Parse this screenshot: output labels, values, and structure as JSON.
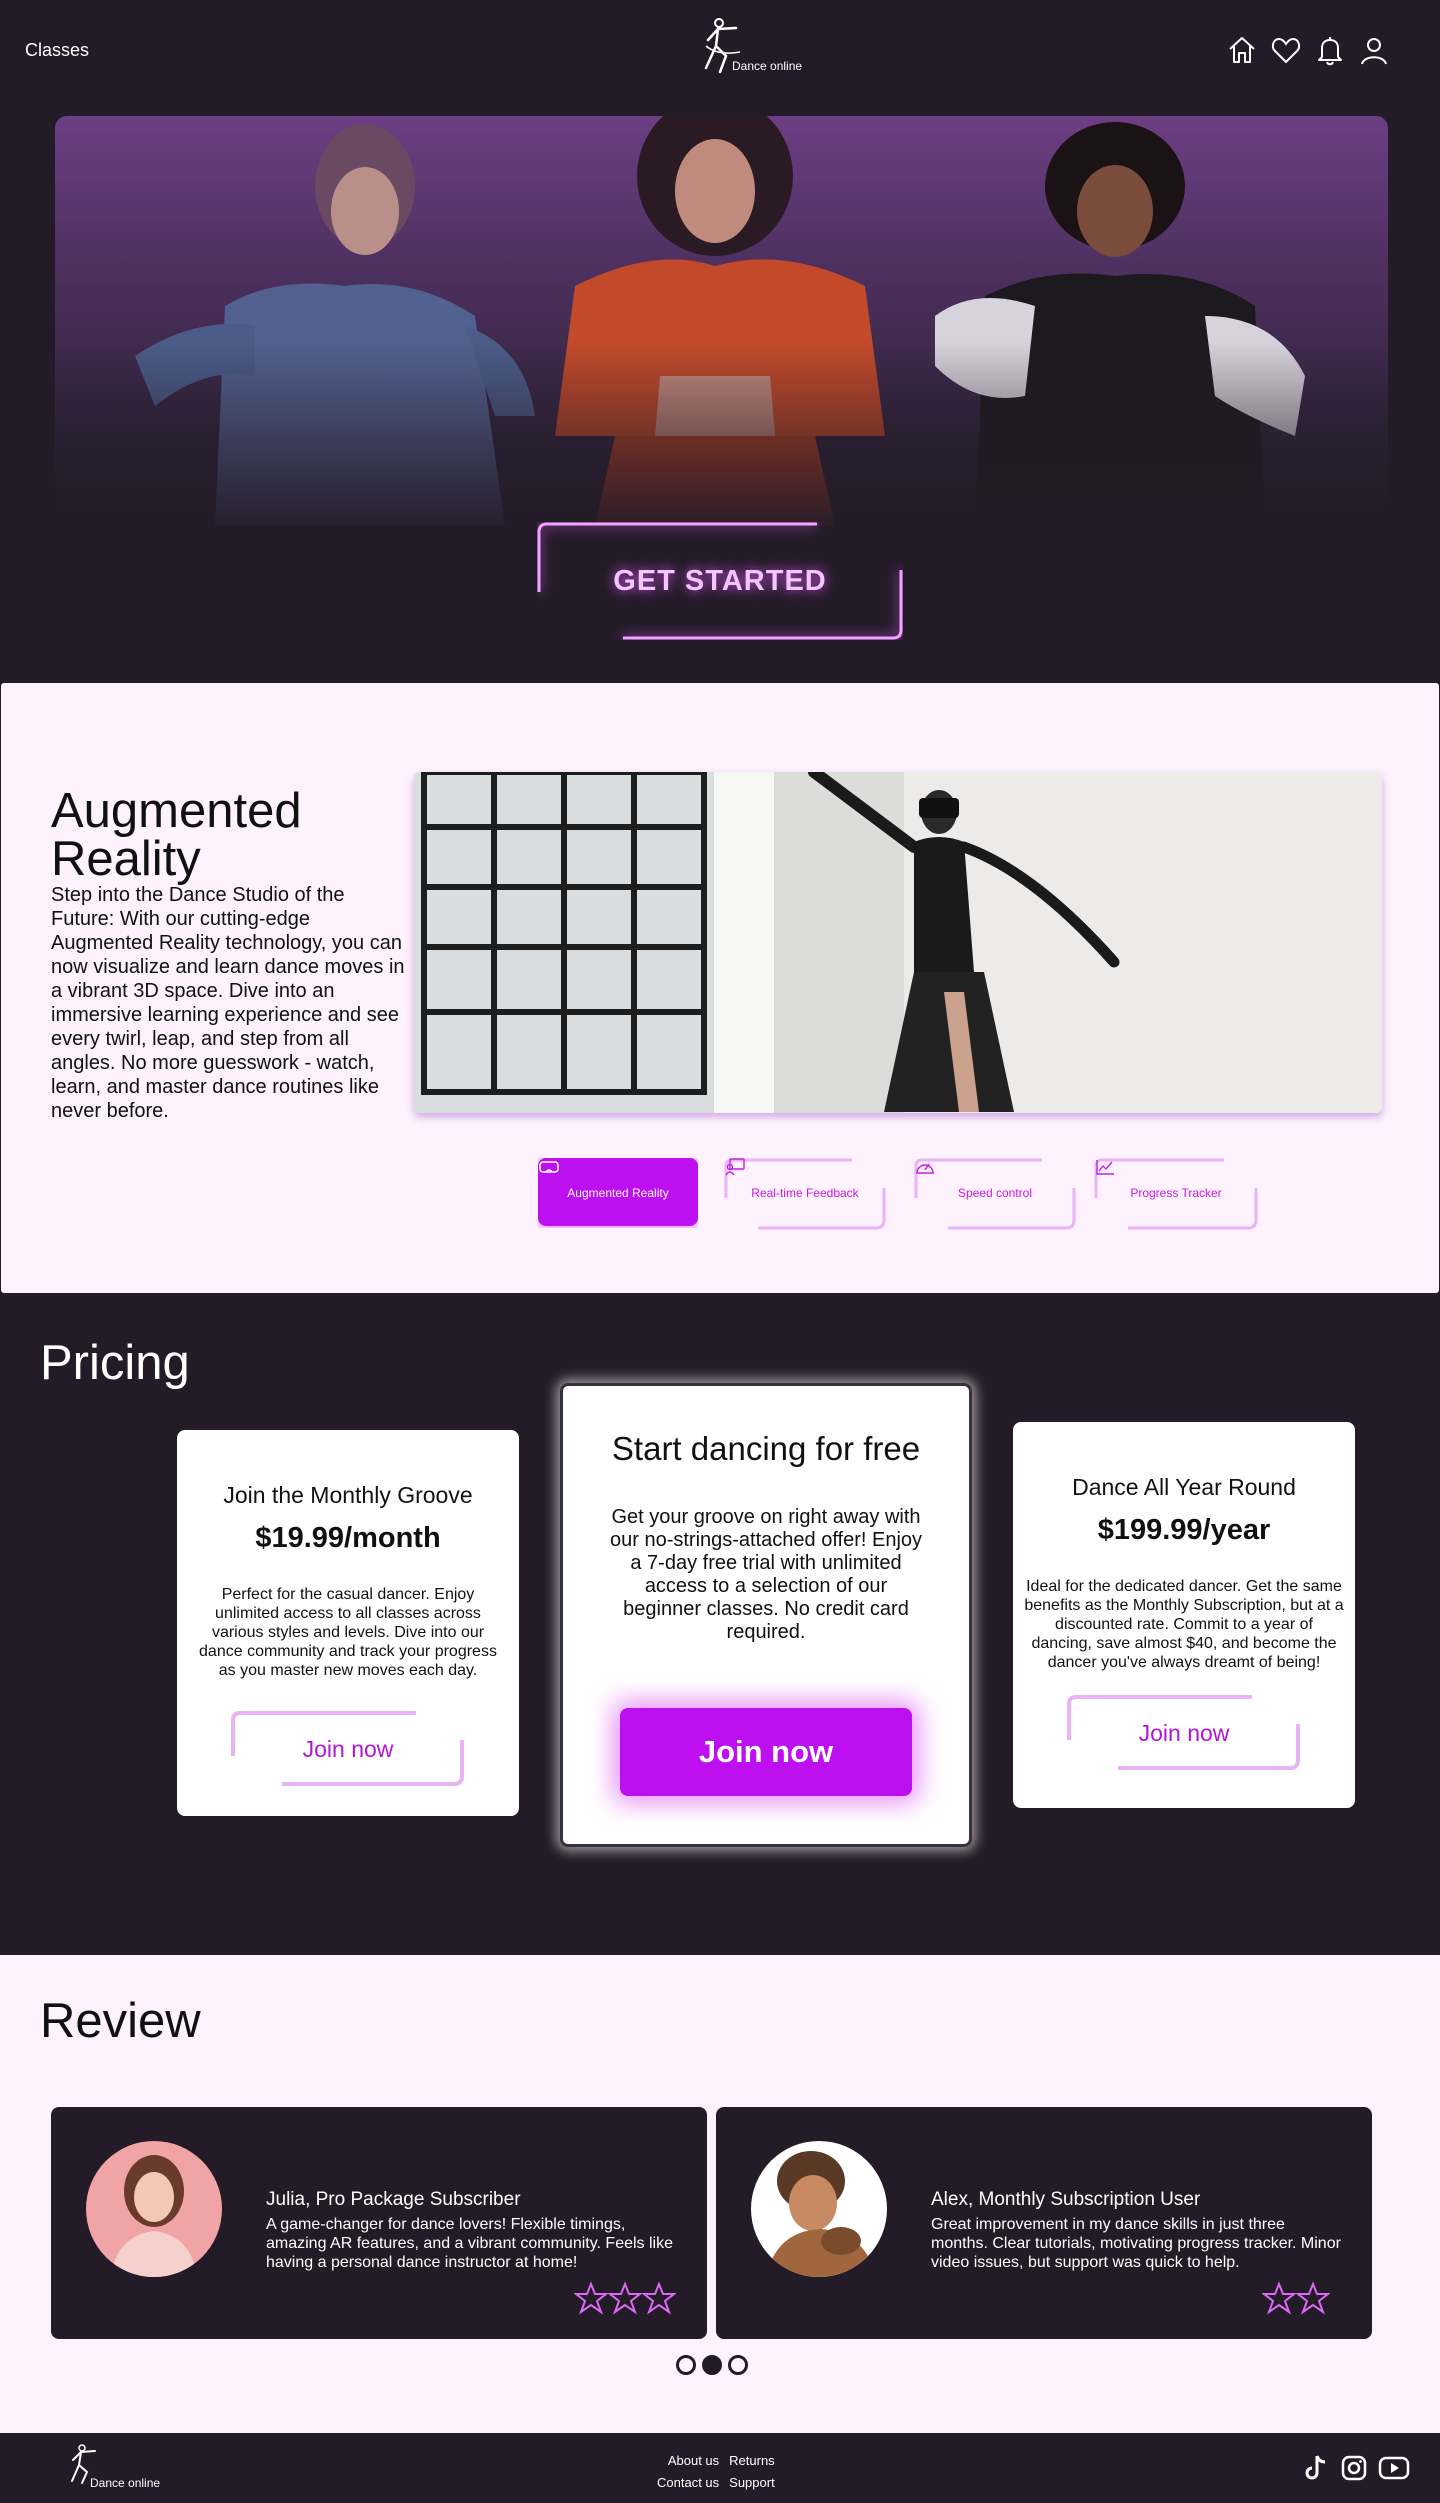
{
  "header": {
    "nav_classes": "Classes",
    "logo_text": "Dance online",
    "icons": [
      "home-icon",
      "heart-icon",
      "bell-icon",
      "user-icon"
    ]
  },
  "hero": {
    "cta_label": "GET STARTED"
  },
  "ar": {
    "title": "Augmented Reality",
    "body": "Step into the Dance Studio of the Future: With our cutting-edge Augmented Reality technology, you can now visualize and learn dance moves in a vibrant 3D space. Dive into an immersive learning experience and see every twirl, leap, and step from all angles. No more guesswork - watch, learn, and master dance routines like never before.",
    "tabs": [
      {
        "label": "Augmented Reality",
        "icon": "vr-headset-icon",
        "active": true
      },
      {
        "label": "Real-time Feedback",
        "icon": "feedback-icon",
        "active": false
      },
      {
        "label": "Speed control",
        "icon": "speedometer-icon",
        "active": false
      },
      {
        "label": "Progress Tracker",
        "icon": "chart-icon",
        "active": false
      }
    ]
  },
  "pricing": {
    "title": "Pricing",
    "monthly": {
      "title": "Join the Monthly Groove",
      "price": "$19.99/month",
      "desc": "Perfect for the casual dancer. Enjoy unlimited access to all classes across various styles and levels. Dive into our dance community and track your progress as you master new moves each day.",
      "button": "Join now"
    },
    "free": {
      "title": "Start dancing for free",
      "desc": "Get your groove on right away with our no-strings-attached offer! Enjoy a 7-day free trial with unlimited access to a selection of our beginner classes. No credit card required.",
      "button": "Join now"
    },
    "yearly": {
      "title": "Dance All Year Round",
      "price": "$199.99/year",
      "desc": "Ideal for the dedicated dancer. Get the same benefits as the Monthly Subscription, but at a discounted rate. Commit to a year of dancing, save almost $40, and become the dancer you've always dreamt of being!",
      "button": "Join now"
    }
  },
  "review": {
    "title": "Review",
    "items": [
      {
        "name": "Julia, Pro Package Subscriber",
        "text": "A game-changer for dance lovers! Flexible timings, amazing AR features, and a vibrant community. Feels like having a personal dance instructor at home!",
        "stars": 3
      },
      {
        "name": "Alex, Monthly Subscription User",
        "text": "Great improvement in my dance skills in just three months. Clear tutorials, motivating progress tracker. Minor video issues, but support was quick to help.",
        "stars": 2
      }
    ],
    "carousel_pages": 3,
    "carousel_active": 2
  },
  "footer": {
    "logo_text": "Dance online",
    "links": [
      "About us",
      "Returns",
      "Contact us",
      "Support"
    ],
    "social": [
      "tiktok-icon",
      "instagram-icon",
      "youtube-icon"
    ]
  },
  "colors": {
    "background_dark": "#241b28",
    "background_light": "#fdf2fd",
    "accent": "#bd0ff0",
    "neon": "#e15cff"
  }
}
